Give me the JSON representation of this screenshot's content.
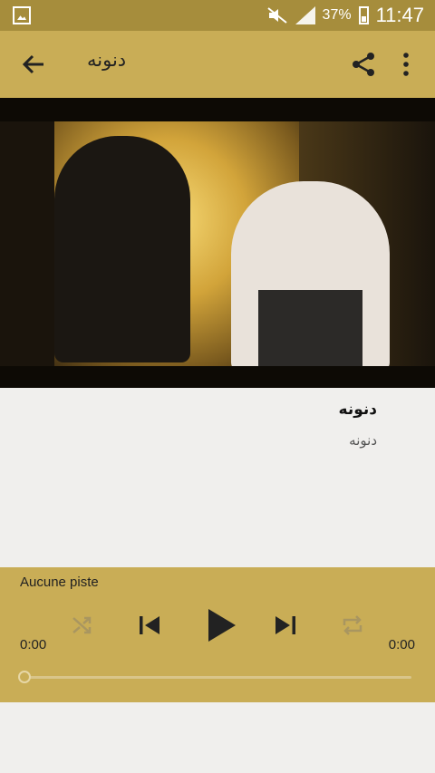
{
  "status_bar": {
    "battery_percent": "37%",
    "time": "11:47"
  },
  "app_bar": {
    "title": "دنونه"
  },
  "now_playing": {
    "title": "دنونه",
    "artist": "دنونه"
  },
  "player": {
    "track_label": "Aucune piste",
    "elapsed": "0:00",
    "duration": "0:00",
    "progress": 0
  },
  "colors": {
    "status_bar": "#a68d3c",
    "app_bar": "#c9ad56",
    "player": "#c9ad56",
    "background": "#f0efed"
  }
}
